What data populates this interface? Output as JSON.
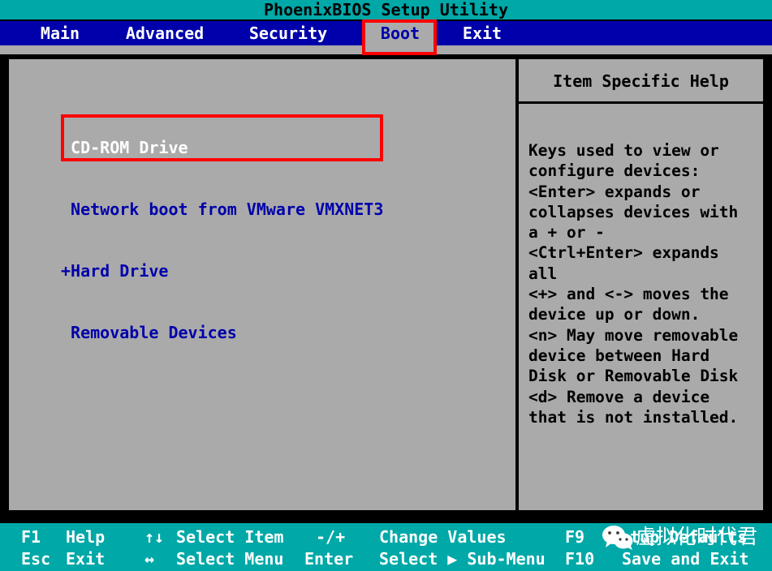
{
  "title_bar": {
    "title": "PhoenixBIOS Setup Utility"
  },
  "menu_bar": {
    "tabs": [
      {
        "label": "Main",
        "active": false
      },
      {
        "label": "Advanced",
        "active": false
      },
      {
        "label": "Security",
        "active": false
      },
      {
        "label": "Boot",
        "active": true
      },
      {
        "label": "Exit",
        "active": false
      }
    ]
  },
  "boot_panel": {
    "items": [
      {
        "label": " CD-ROM Drive",
        "selected": true
      },
      {
        "label": " Network boot from VMware VMXNET3",
        "selected": false
      },
      {
        "label": "+Hard Drive",
        "selected": false
      },
      {
        "label": " Removable Devices",
        "selected": false
      }
    ]
  },
  "help_panel": {
    "title": "Item Specific Help",
    "body": "Keys used to view or\nconfigure devices:\n<Enter> expands or\ncollapses devices with\na + or -\n<Ctrl+Enter> expands\nall\n<+> and <-> moves the\ndevice up or down.\n<n> May move removable\ndevice between Hard\nDisk or Removable Disk\n<d> Remove a device\nthat is not installed."
  },
  "status_bar": {
    "row1": {
      "key1": "F1",
      "action1": "Help",
      "key2": "↑↓",
      "action2": "Select Item",
      "key3": "-/+",
      "action3": "Change Values",
      "key4": "F9",
      "action4": "Setup Defaults"
    },
    "row2": {
      "key1": "Esc",
      "action1": "Exit",
      "key2": "↔",
      "action2": "Select Menu",
      "key3": "Enter",
      "action3": "Select ▶ Sub-Menu",
      "key4": "F10",
      "action4": "Save and Exit"
    }
  },
  "watermark": {
    "text": "虚拟化时代君",
    "logo": "wechat-logo"
  },
  "colors": {
    "title_bar_bg": "#00a8a8",
    "menu_bar_bg": "#0000aa",
    "panel_bg": "#aaaaaa",
    "text_blue": "#0000aa",
    "text_white": "#ffffff",
    "annotation_red": "#ff0000",
    "status_bar_bg": "#00a8a8"
  }
}
